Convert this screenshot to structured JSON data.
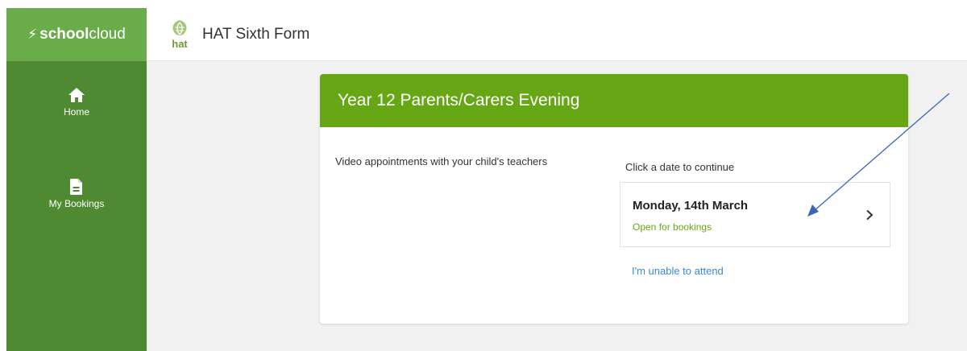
{
  "brand": {
    "bolt": "⚡",
    "bold": "school",
    "light": "cloud"
  },
  "sidebar": {
    "items": [
      {
        "label": "Home",
        "icon": "home-icon"
      },
      {
        "label": "My Bookings",
        "icon": "document-icon"
      }
    ]
  },
  "header": {
    "school_name": "HAT Sixth Form",
    "logo_text": "hat"
  },
  "event": {
    "title": "Year 12 Parents/Carers Evening",
    "description": "Video appointments with your child's teachers",
    "prompt": "Click a date to continue",
    "dates": [
      {
        "label": "Monday, 14th March",
        "status": "Open for bookings"
      }
    ],
    "unable_link": "I'm unable to attend"
  },
  "colors": {
    "sidebar": "#4f8a33",
    "brand_bar": "#6aab4a",
    "card_header": "#67a716",
    "link": "#3b8bd5",
    "annotation_arrow": "#3b66b8"
  }
}
